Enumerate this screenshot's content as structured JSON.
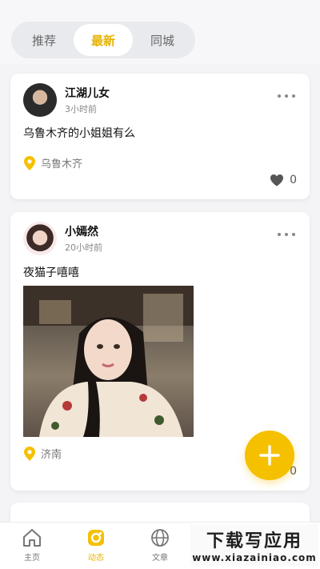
{
  "tabs": [
    {
      "label": "推荐",
      "active": false
    },
    {
      "label": "最新",
      "active": true
    },
    {
      "label": "同城",
      "active": false
    }
  ],
  "posts": [
    {
      "username": "江湖儿女",
      "time": "3小时前",
      "content": "乌鲁木齐的小姐姐有么",
      "location": "乌鲁木齐",
      "likes": "0"
    },
    {
      "username": "小嫣然",
      "time": "20小时前",
      "content": "夜猫子嘻嘻",
      "location": "济南",
      "likes": "0"
    }
  ],
  "nav": {
    "home": "主页",
    "feed": "动态",
    "articles": "文章"
  },
  "watermark": {
    "line1": "下载写应用",
    "line2": "www.xiazainiao.com"
  },
  "colors": {
    "accent": "#f5c000",
    "active_text": "#e7b200"
  }
}
